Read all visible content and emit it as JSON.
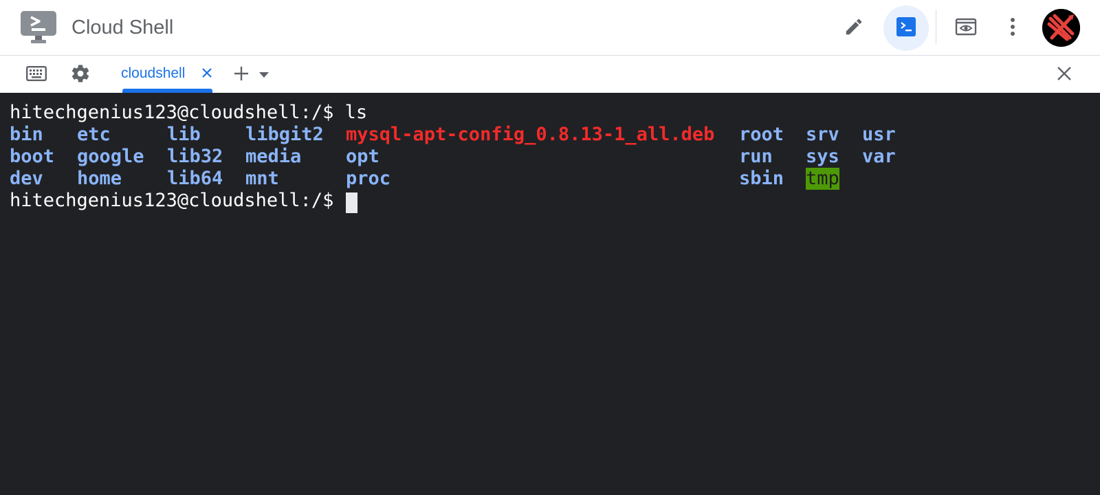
{
  "header": {
    "title": "Cloud Shell",
    "logo_icon": "cloud-shell-terminal-icon",
    "actions": [
      {
        "name": "open-editor",
        "icon": "pencil-icon"
      },
      {
        "name": "open-terminal",
        "icon": "terminal-icon",
        "active": true
      },
      {
        "name": "web-preview",
        "icon": "preview-eye-icon"
      },
      {
        "name": "more-options",
        "icon": "more-vert-icon"
      }
    ],
    "avatar_icon": "user-avatar"
  },
  "tabbar": {
    "keyboard_icon": "keyboard-icon",
    "settings_icon": "gear-icon",
    "tabs": [
      {
        "label": "cloudshell",
        "active": true
      }
    ],
    "add_icon": "plus-icon",
    "dropdown_icon": "caret-down-icon",
    "close_icon": "close-icon"
  },
  "terminal": {
    "prompt1": "hitechgenius123@cloudshell:/$ ls",
    "ls_rows": [
      [
        "bin",
        "etc",
        "lib",
        "libgit2",
        "mysql-apt-config_0.8.13-1_all.deb",
        "root",
        "srv",
        "usr"
      ],
      [
        "boot",
        "google",
        "lib32",
        "media",
        "opt",
        "run",
        "sys",
        "var"
      ],
      [
        "dev",
        "home",
        "lib64",
        "mnt",
        "proc",
        "sbin",
        "tmp",
        ""
      ]
    ],
    "prompt2": "hitechgenius123@cloudshell:/$ ",
    "colors": {
      "directory": "#8ab4f8",
      "archive": "#f32b2b",
      "sticky_bg": "#4e9a06",
      "background": "#202124"
    }
  }
}
